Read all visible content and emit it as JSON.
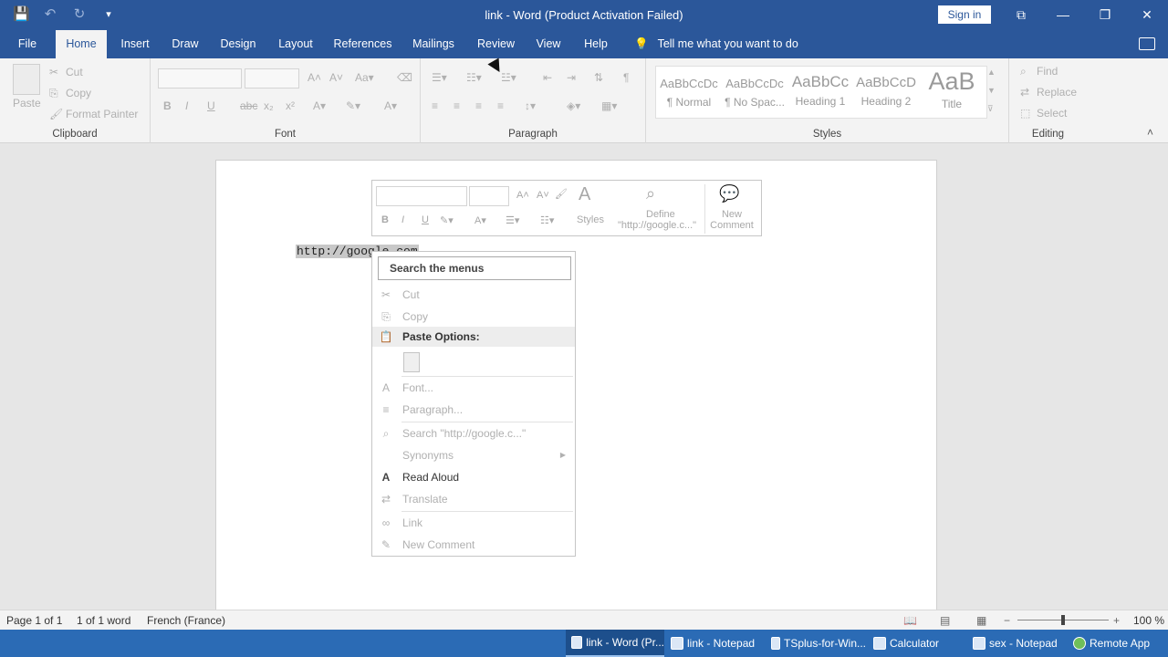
{
  "window": {
    "title": "link  -  Word (Product Activation Failed)",
    "sign_in": "Sign in",
    "controls": {
      "ribbon_display": "⧉",
      "minimize": "—",
      "restore": "❐",
      "close": "✕"
    }
  },
  "qat": {
    "save": "💾",
    "undo": "↶",
    "redo": "↻",
    "customize": "▾"
  },
  "tabs": [
    "File",
    "Home",
    "Insert",
    "Draw",
    "Design",
    "Layout",
    "References",
    "Mailings",
    "Review",
    "View",
    "Help"
  ],
  "active_tab": "Home",
  "tell_me": "Tell me what you want to do",
  "ribbon": {
    "clipboard": {
      "paste": "Paste",
      "cut": "Cut",
      "copy": "Copy",
      "format_painter": "Format Painter",
      "label": "Clipboard"
    },
    "font": {
      "label": "Font",
      "bold": "B",
      "italic": "I",
      "underline": "U",
      "strike": "abc",
      "sub": "x₂",
      "sup": "x²"
    },
    "paragraph": {
      "label": "Paragraph",
      "pilcrow": "¶"
    },
    "styles": {
      "label": "Styles",
      "items": [
        {
          "preview": "AaBbCcDc",
          "name": "¶ Normal"
        },
        {
          "preview": "AaBbCcDc",
          "name": "¶ No Spac..."
        },
        {
          "preview": "AaBbCc",
          "name": "Heading 1"
        },
        {
          "preview": "AaBbCcD",
          "name": "Heading 2"
        },
        {
          "preview": "AaB",
          "name": "Title"
        }
      ]
    },
    "editing": {
      "label": "Editing",
      "find": "Find",
      "replace": "Replace",
      "select": "Select"
    }
  },
  "document": {
    "text": "http://google.com"
  },
  "mini_toolbar": {
    "styles": "Styles",
    "define_line1": "Define",
    "define_line2": "\"http://google.c...\"",
    "new_comment_line1": "New",
    "new_comment_line2": "Comment"
  },
  "context_menu": {
    "search_placeholder": "Search the menus",
    "items": [
      {
        "label": "Cut",
        "icon": "✂",
        "enabled": false
      },
      {
        "label": "Copy",
        "icon": "⎘",
        "enabled": false
      },
      {
        "label": "Paste Options:",
        "icon": "📋",
        "enabled": true
      },
      {
        "label": "Font...",
        "icon": "A",
        "enabled": false
      },
      {
        "label": "Paragraph...",
        "icon": "≡",
        "enabled": false
      },
      {
        "label": "Search \"http://google.c...\"",
        "icon": "⌕",
        "enabled": false
      },
      {
        "label": "Synonyms",
        "icon": "",
        "enabled": false
      },
      {
        "label": "Read Aloud",
        "icon": "A",
        "enabled": true
      },
      {
        "label": "Translate",
        "icon": "⇄",
        "enabled": false
      },
      {
        "label": "Link",
        "icon": "∞",
        "enabled": false
      },
      {
        "label": "New Comment",
        "icon": "✎",
        "enabled": false
      }
    ]
  },
  "status": {
    "page": "Page 1 of 1",
    "words": "1 of 1 word",
    "language": "French (France)",
    "zoom": "100 %"
  },
  "taskbar": [
    {
      "label": "link - Word (Pr..."
    },
    {
      "label": "link - Notepad"
    },
    {
      "label": "TSplus-for-Win..."
    },
    {
      "label": "Calculator"
    },
    {
      "label": "sex - Notepad"
    },
    {
      "label": "Remote App"
    }
  ]
}
